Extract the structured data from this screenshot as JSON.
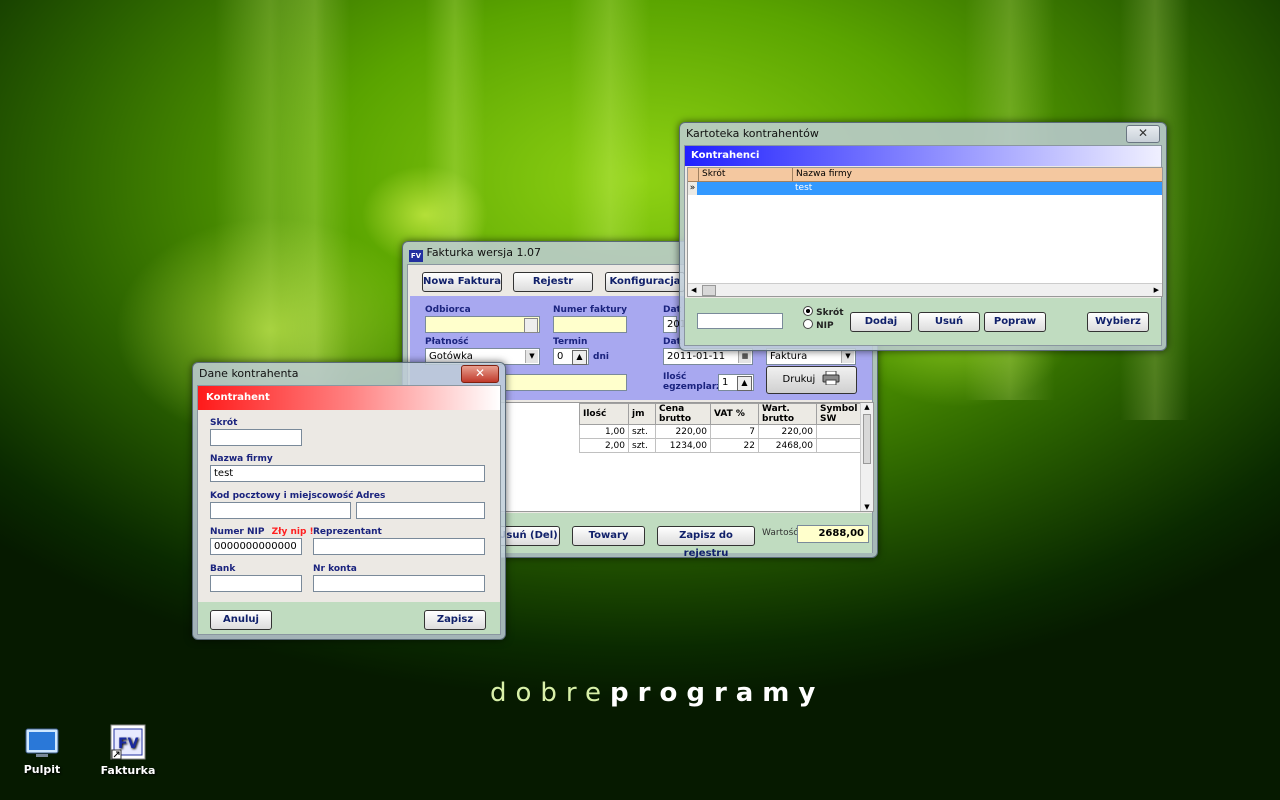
{
  "desktop": {
    "brand_light": "dobre",
    "brand_bold": "programy",
    "icons": [
      {
        "label": "Pulpit"
      },
      {
        "label": "Fakturka"
      }
    ]
  },
  "main_window": {
    "title": "Fakturka  wersja 1.07",
    "buttons": {
      "new_invoice": "Nowa Faktura",
      "register": "Rejestr",
      "config": "Konfiguracja"
    },
    "fields": {
      "recipient_label": "Odbiorca",
      "invoice_number_label": "Numer faktury",
      "date_label_1": "Dat",
      "date_value_1": "201",
      "payment_label": "Płatność",
      "payment_value": "Gotówka",
      "term_label": "Termin",
      "term_value": "0",
      "term_unit": "dni",
      "date_label_2": "Dat",
      "date_value_2": "2011-01-11",
      "doc_type_value": "Faktura",
      "copies_label": "Ilość egzemplarzy",
      "copies_value": "1",
      "print_button": "Drukuj"
    },
    "items_table": {
      "columns": [
        "Ilość",
        "jm",
        "Cena brutto",
        "VAT %",
        "Wart. brutto",
        "Symbol SW"
      ],
      "rows": [
        [
          "1,00",
          "szt.",
          "220,00",
          "7",
          "220,00",
          ""
        ],
        [
          "2,00",
          "szt.",
          "1234,00",
          "22",
          "2468,00",
          ""
        ]
      ]
    },
    "bottom": {
      "delete_button": "Usuń (Del)",
      "goods_button": "Towary",
      "save_register_button": "Zapisz do rejestru",
      "value_label": "Wartość",
      "value": "2688,00"
    }
  },
  "contractors_window": {
    "title": "Kartoteka kontrahentów",
    "header": "Kontrahenci",
    "columns": [
      "Skrót",
      "Nazwa firmy"
    ],
    "rows": [
      {
        "short": "",
        "name": "test"
      }
    ],
    "row_marker": "»",
    "radio": {
      "short_label": "Skrót",
      "nip_label": "NIP"
    },
    "buttons": {
      "add": "Dodaj",
      "remove": "Usuń",
      "edit": "Popraw",
      "choose": "Wybierz"
    }
  },
  "contractor_dialog": {
    "title": "Dane kontrahenta",
    "header": "Kontrahent",
    "labels": {
      "short": "Skrót",
      "company": "Nazwa firmy",
      "postal": "Kod pocztowy i miejscowość",
      "address": "Adres",
      "nip": "Numer NIP",
      "nip_error": "Zły nip !",
      "representative": "Reprezentant",
      "bank": "Bank",
      "account": "Nr konta"
    },
    "values": {
      "short": "",
      "company": "test",
      "postal": "",
      "address": "",
      "nip": "0000000000000",
      "representative": "",
      "bank": "",
      "account": ""
    },
    "buttons": {
      "cancel": "Anuluj",
      "save": "Zapisz"
    }
  },
  "colors": {
    "accent_blue": "#2020ff",
    "accent_red": "#ff1a1a",
    "panel_lilac": "#a8a8f0",
    "selection_blue": "#3399ff",
    "grid_header_peach": "#f4c8a0",
    "footer_green": "#c0dcc0"
  }
}
